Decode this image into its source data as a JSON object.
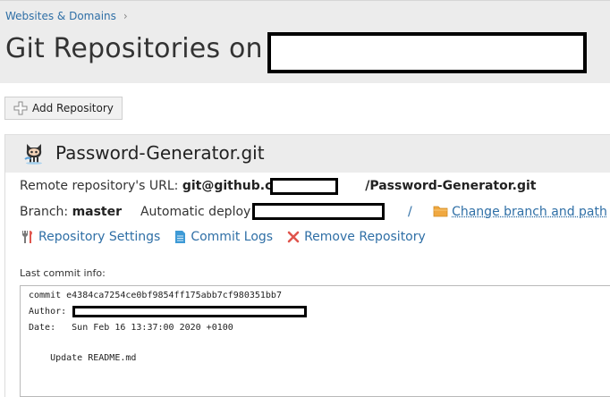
{
  "breadcrumb": {
    "label": "Websites & Domains",
    "separator": "›"
  },
  "page": {
    "title": "Git Repositories on"
  },
  "toolbar": {
    "add_repository_label": "Add Repository"
  },
  "repository": {
    "name": "Password-Generator.git",
    "remote_url_label": "Remote repository's URL:",
    "remote_url_prefix": "git@github.com:",
    "remote_url_suffix": "/Password-Generator.git",
    "branch_label": "Branch:",
    "branch_value": "master",
    "deploy_label": "Automatic deploy to",
    "deploy_prefix": "/",
    "deploy_suffix": "/",
    "change_branch_label": "Change branch and path"
  },
  "actions": {
    "settings_label": "Repository Settings",
    "commit_logs_label": "Commit Logs",
    "remove_label": "Remove Repository"
  },
  "commit": {
    "label": "Last commit info:",
    "line_commit": "commit e4384ca7254ce0bf9854ff175abb7cf980351bb7",
    "line_author": "Author:",
    "line_date": "Date:   Sun Feb 16 13:37:00 2020 +0100",
    "line_message": "    Update README.md"
  },
  "colors": {
    "link": "#2f6fa6",
    "remove_icon": "#e0554d",
    "folder_icon": "#f0a840"
  }
}
